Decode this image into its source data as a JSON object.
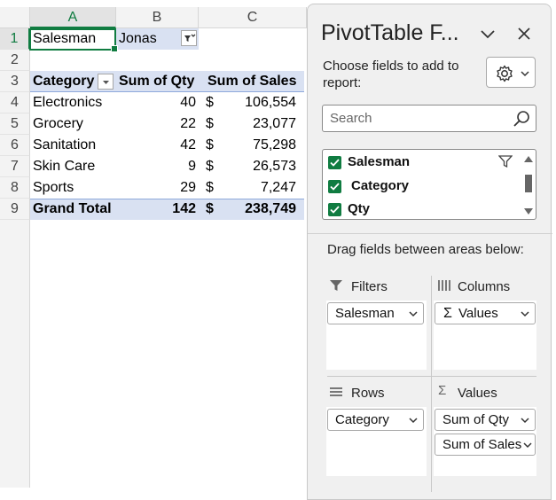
{
  "sheet": {
    "columns": [
      "A",
      "B",
      "C"
    ],
    "rows": [
      "1",
      "2",
      "3",
      "4",
      "5",
      "6",
      "7",
      "8",
      "9"
    ],
    "filter": {
      "label": "Salesman",
      "value": "Jonas"
    },
    "headers": {
      "category": "Category",
      "qty": "Sum of Qty",
      "sales": "Sum of Sales"
    },
    "data": [
      {
        "category": "Electronics",
        "qty": "40",
        "currency": "$",
        "sales": "106,554"
      },
      {
        "category": "Grocery",
        "qty": "22",
        "currency": "$",
        "sales": "23,077"
      },
      {
        "category": "Sanitation",
        "qty": "42",
        "currency": "$",
        "sales": "75,298"
      },
      {
        "category": "Skin Care",
        "qty": "9",
        "currency": "$",
        "sales": "26,573"
      },
      {
        "category": "Sports",
        "qty": "29",
        "currency": "$",
        "sales": "7,247"
      }
    ],
    "total": {
      "label": "Grand Total",
      "qty": "142",
      "currency": "$",
      "sales": "238,749"
    }
  },
  "pane": {
    "title": "PivotTable F...",
    "choose_text": "Choose fields to add to report:",
    "search_placeholder": "Search",
    "fields": [
      {
        "label": "Salesman",
        "checked": true,
        "filtered": true
      },
      {
        "label": "Category",
        "checked": true,
        "filtered": false
      },
      {
        "label": "Qty",
        "checked": true,
        "filtered": false
      }
    ],
    "drag_text": "Drag fields between areas below:",
    "areas": {
      "filters": {
        "title": "Filters",
        "items": [
          "Salesman"
        ]
      },
      "columns": {
        "title": "Columns",
        "items": [
          "Values"
        ]
      },
      "rows": {
        "title": "Rows",
        "items": [
          "Category"
        ]
      },
      "values": {
        "title": "Values",
        "items": [
          "Sum of Qty",
          "Sum of Sales"
        ]
      }
    }
  },
  "colors": {
    "accent": "#107c41",
    "pivot_header": "#d9e1f2",
    "pivot_border": "#8ea9db"
  }
}
